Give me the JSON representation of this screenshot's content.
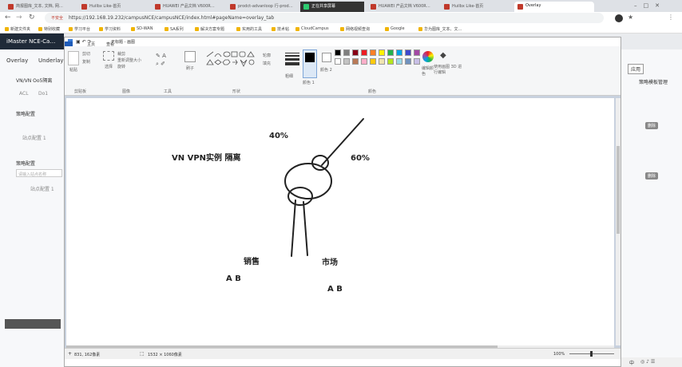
{
  "browser": {
    "tabs": [
      {
        "label": "简报图库_文本, 文档, 网…"
      },
      {
        "label": "Huilbx Like-首页"
      },
      {
        "label": "HUAWEI 产品文档 V600R…"
      },
      {
        "label": "prodct-advanloop 行-prod…"
      },
      {
        "label": "正在共享屏幕"
      },
      {
        "label": "HUAWEI 产品文档 V600R…"
      },
      {
        "label": "Huilbx Like-首页"
      },
      {
        "label": "Overlay"
      }
    ],
    "share_banner": "共享屏幕中",
    "url_prefix": "不安全",
    "url": "https://192.168.19.232/campusNCE/campusNCE/index.html#pageName=overlay_tab",
    "bookmarks": [
      "新建文件夹",
      "特别收藏",
      "学习平台",
      "学习资料",
      "SD-WAN",
      "SA系列",
      "解决方案专题",
      "实用的工具",
      "技术帖",
      "CloudCampus",
      "网络视频查询",
      "Google",
      "华为图库_文本、文…"
    ]
  },
  "app": {
    "logo": "iMaster NCE-Ca…",
    "nav": [
      "Overlay",
      "Underlay"
    ],
    "left_items": [
      "VN/VN Oo5隔离",
      "ACL",
      "Do1",
      "策略配置",
      "站点配置 1",
      "策略配置",
      "请输入站点名称",
      "站点配置 1"
    ],
    "right_items": [
      "+",
      "应用",
      "策略模板管理",
      "删除",
      "删除"
    ]
  },
  "paint": {
    "title_tabs": [
      "主页",
      "查看"
    ],
    "window_title": "无标题 - 画图",
    "ribbon_groups": [
      "剪贴板",
      "图像",
      "工具",
      "形状",
      "粗细",
      "颜色 1",
      "颜色 2",
      "颜色",
      "编辑颜色",
      "使用画图 3D 进行编辑"
    ],
    "ribbon_labels": [
      "粘贴",
      "剪切",
      "复制",
      "选择",
      "裁剪",
      "重新调整大小",
      "旋转",
      "刷子",
      "轮廓",
      "填充"
    ],
    "status": {
      "position": "831, 162像素",
      "size": "1532 × 1060像素",
      "zoom": "100%"
    },
    "canvas_text": {
      "pct_top": "40%",
      "pct_right": "60%",
      "vn_label": "VN   VPN实例  隔离",
      "sales": "销售",
      "market": "市场",
      "ab_left": "A   B",
      "ab_right": "A B"
    }
  },
  "taskbar": {
    "time": "中"
  },
  "colors": {
    "palette": [
      "#000000",
      "#7f7f7f",
      "#880015",
      "#ed1c24",
      "#ff7f27",
      "#fff200",
      "#22b14c",
      "#00a2e8",
      "#3f48cc",
      "#a349a4",
      "#ffffff",
      "#c3c3c3",
      "#b97a57",
      "#ffaec9",
      "#ffc90e",
      "#efe4b0",
      "#b5e61d",
      "#99d9ea",
      "#7092be",
      "#c8bfe7"
    ],
    "accent": "#c0392b"
  }
}
